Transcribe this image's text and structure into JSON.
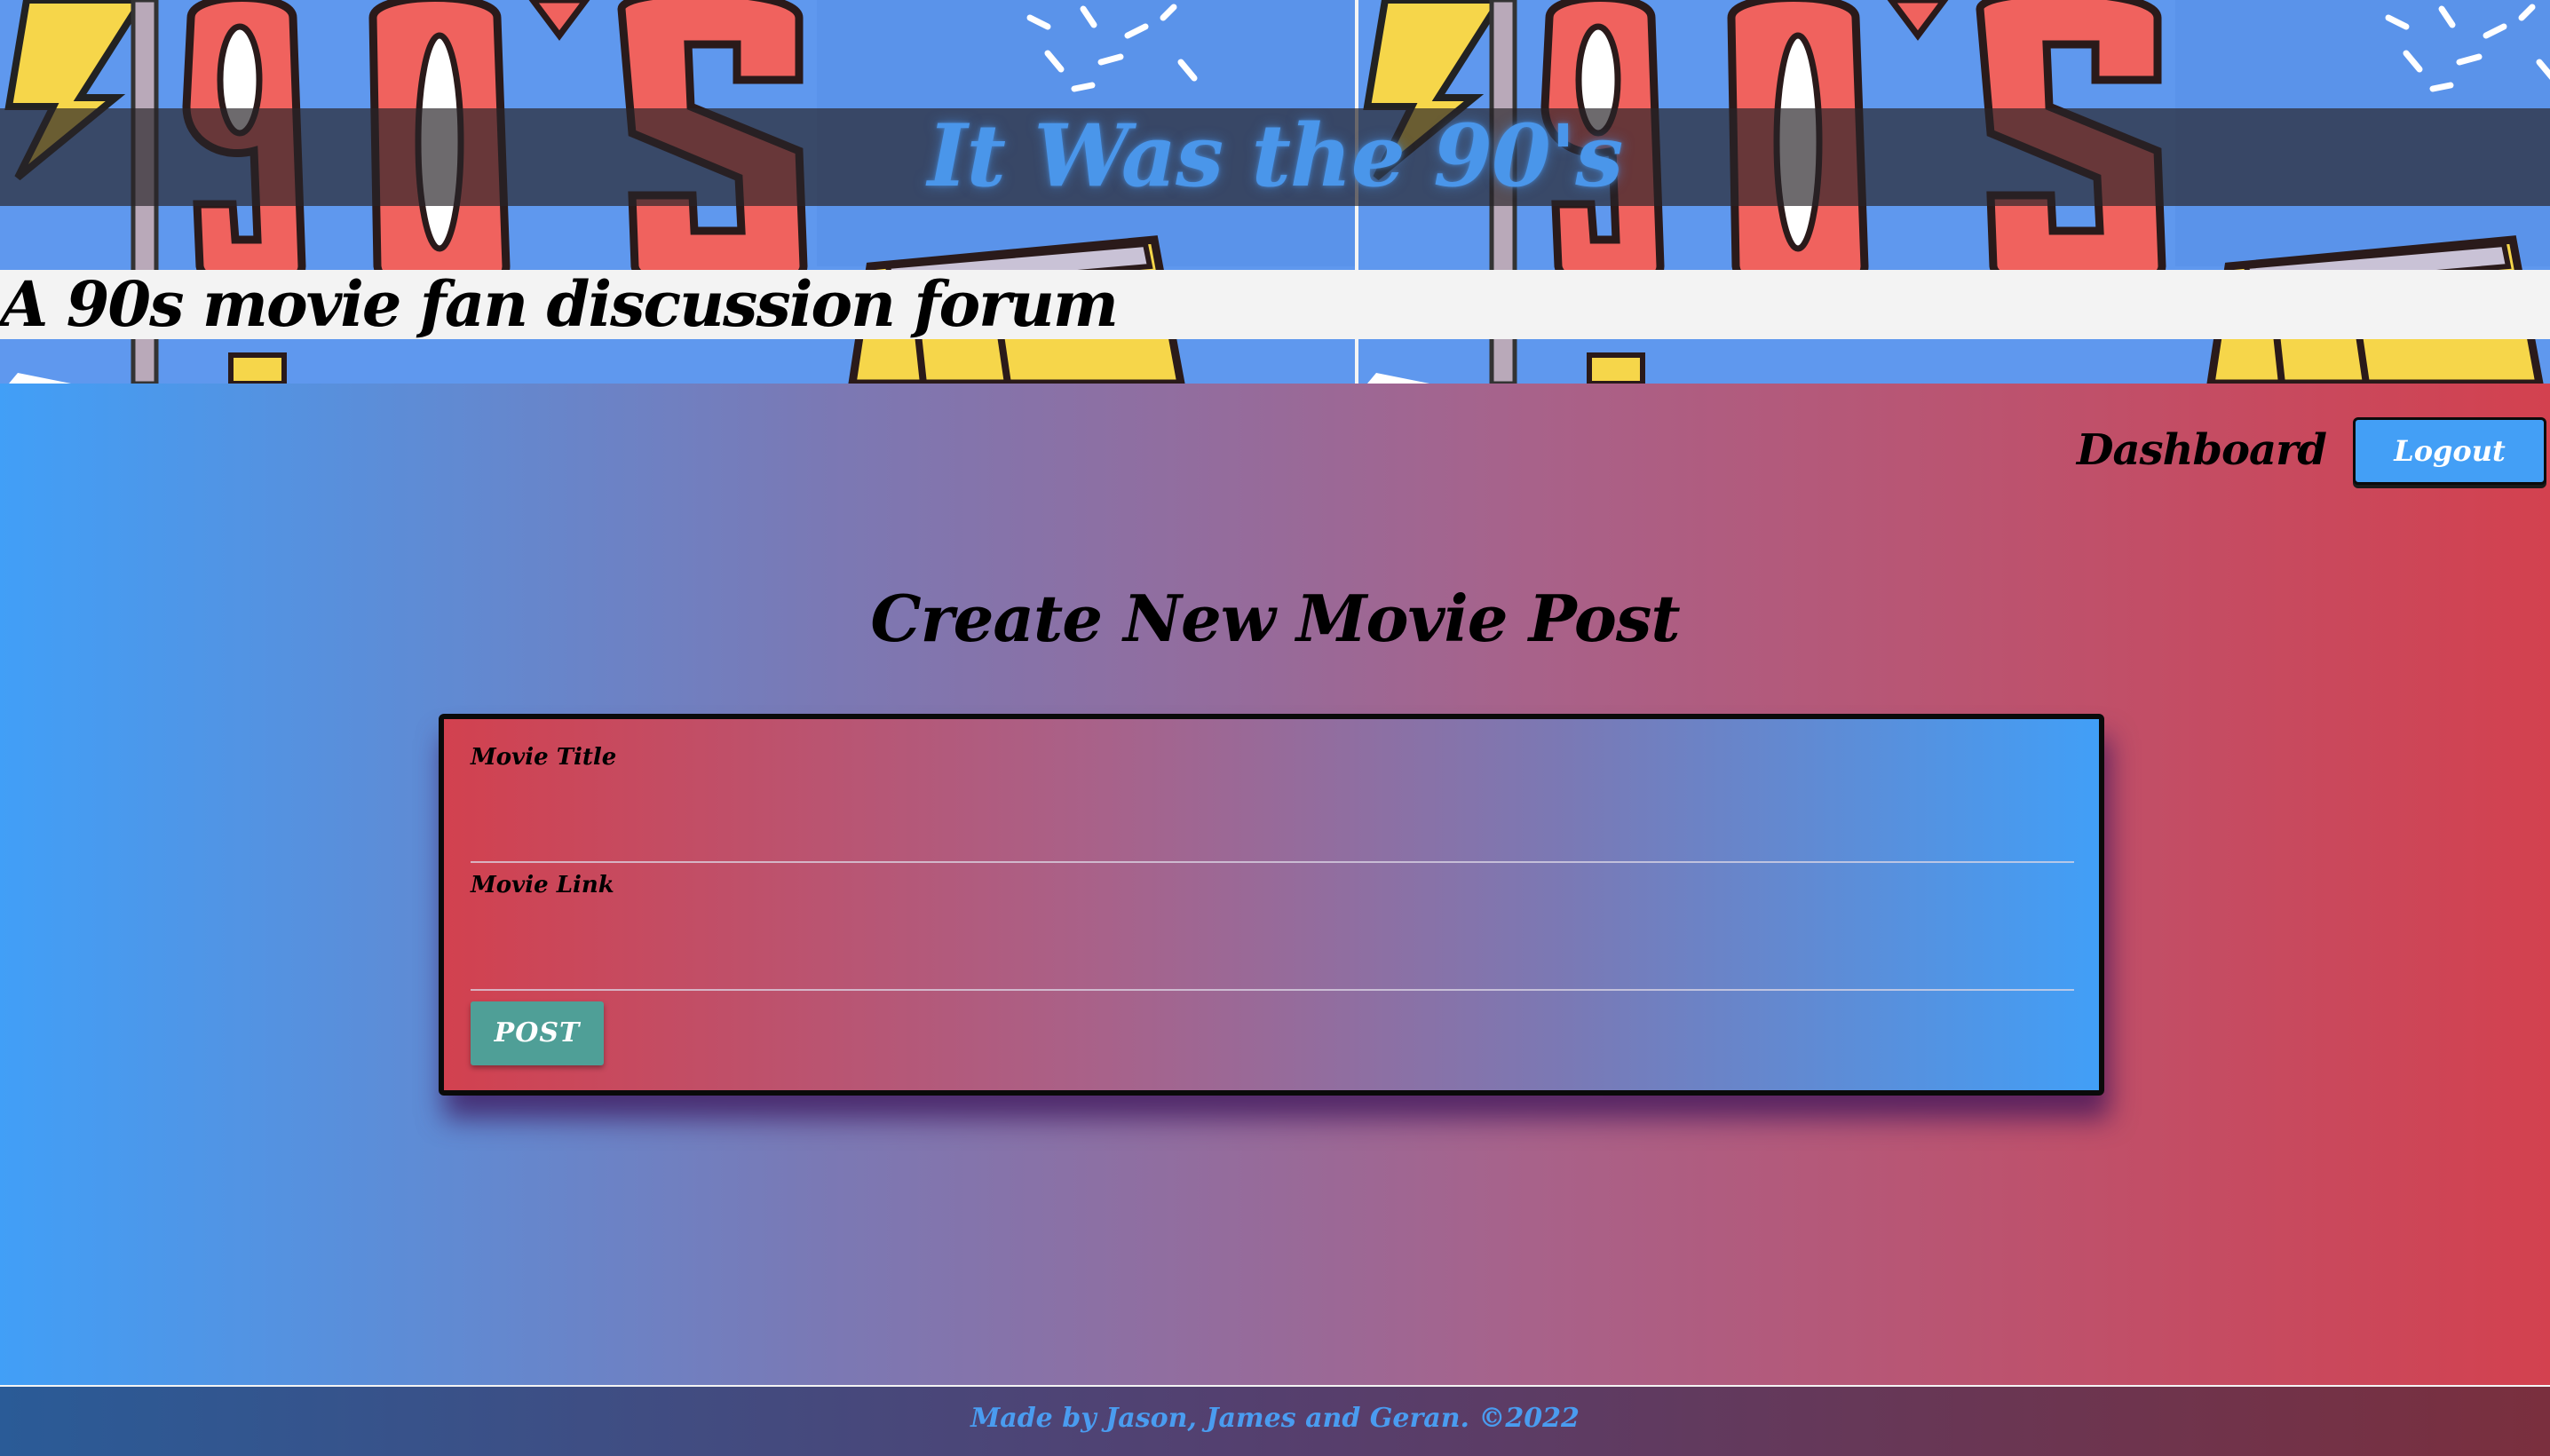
{
  "header": {
    "site_title": "It Was the 90's",
    "tagline": "A 90s movie fan discussion forum",
    "banner_artwork": "90's"
  },
  "nav": {
    "dashboard_label": "Dashboard",
    "logout_label": "Logout"
  },
  "main": {
    "heading": "Create New Movie Post",
    "form": {
      "title_label": "Movie Title",
      "title_value": "",
      "link_label": "Movie Link",
      "link_value": "",
      "submit_label": "POST"
    }
  },
  "footer": {
    "credits": "Made by Jason, James and Geran. ©2022"
  },
  "colors": {
    "gradient_blue": "#419ff7",
    "gradient_red": "#d3414f",
    "logout_button": "#439ff6",
    "post_button": "#4f9f97",
    "title_text": "#4a96ea"
  },
  "icons": {
    "banner_pattern": "retro-90s-banner-image"
  }
}
